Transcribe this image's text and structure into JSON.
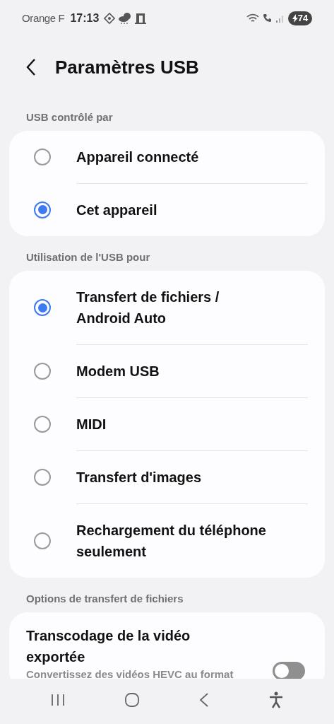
{
  "status_bar": {
    "carrier": "Orange F",
    "time": "17:13",
    "battery": "74"
  },
  "header": {
    "title": "Paramètres USB"
  },
  "sections": [
    {
      "label": "USB contrôlé par",
      "kind": "radio",
      "options": [
        {
          "label": "Appareil connecté",
          "selected": false
        },
        {
          "label": "Cet appareil",
          "selected": true
        }
      ]
    },
    {
      "label": "Utilisation de l'USB pour",
      "kind": "radio",
      "options": [
        {
          "label": "Transfert de fichiers / Android Auto",
          "selected": true
        },
        {
          "label": "Modem USB",
          "selected": false
        },
        {
          "label": "MIDI",
          "selected": false
        },
        {
          "label": "Transfert d'images",
          "selected": false
        },
        {
          "label": "Rechargement du téléphone seulement",
          "selected": false
        }
      ]
    },
    {
      "label": "Options de transfert de fichiers",
      "kind": "switch",
      "options": [
        {
          "label": "Transcodage de la vidéo exportée",
          "description": "Convertissez des vidéos HEVC au format",
          "on": false
        }
      ]
    }
  ]
}
